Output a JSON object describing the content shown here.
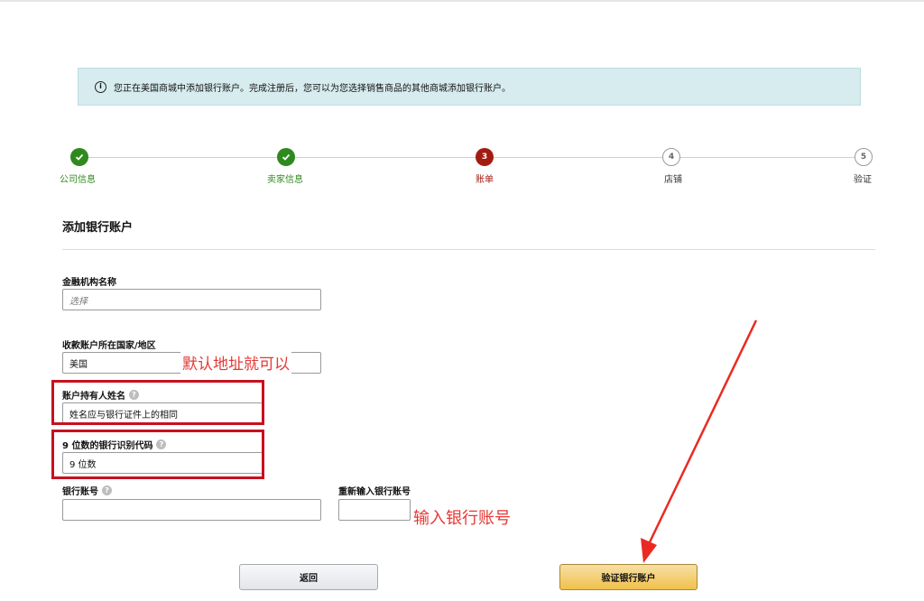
{
  "banner": {
    "icon": "info-icon",
    "text": "您正在美国商城中添加银行账户。完成注册后，您可以为您选择销售商品的其他商城添加银行账户。"
  },
  "steps": [
    {
      "number": "1",
      "label": "公司信息",
      "state": "done"
    },
    {
      "number": "2",
      "label": "卖家信息",
      "state": "done"
    },
    {
      "number": "3",
      "label": "账单",
      "state": "current"
    },
    {
      "number": "4",
      "label": "店铺",
      "state": "todo"
    },
    {
      "number": "5",
      "label": "验证",
      "state": "todo"
    }
  ],
  "section_title": "添加银行账户",
  "fields": {
    "institution": {
      "label": "金融机构名称",
      "placeholder": "选择"
    },
    "country": {
      "label": "收款账户所在国家/地区",
      "value": "美国"
    },
    "holder": {
      "label": "账户持有人姓名",
      "value": "姓名应与银行证件上的相同"
    },
    "routing": {
      "label": "9 位数的银行识别代码",
      "value": "9 位数"
    },
    "account": {
      "label": "银行账号",
      "value": ""
    },
    "account_confirm": {
      "label": "重新输入银行账号",
      "value": ""
    }
  },
  "annotations": {
    "default_address": "默认地址就可以",
    "enter_account": "输入银行账号"
  },
  "buttons": {
    "back": "返回",
    "verify": "验证银行账户"
  },
  "colors": {
    "done": "#2f8a1e",
    "current": "#a31c12",
    "annotation_red": "#e53935",
    "verify_button": "#f0c14b",
    "banner": "#d7ecef"
  }
}
